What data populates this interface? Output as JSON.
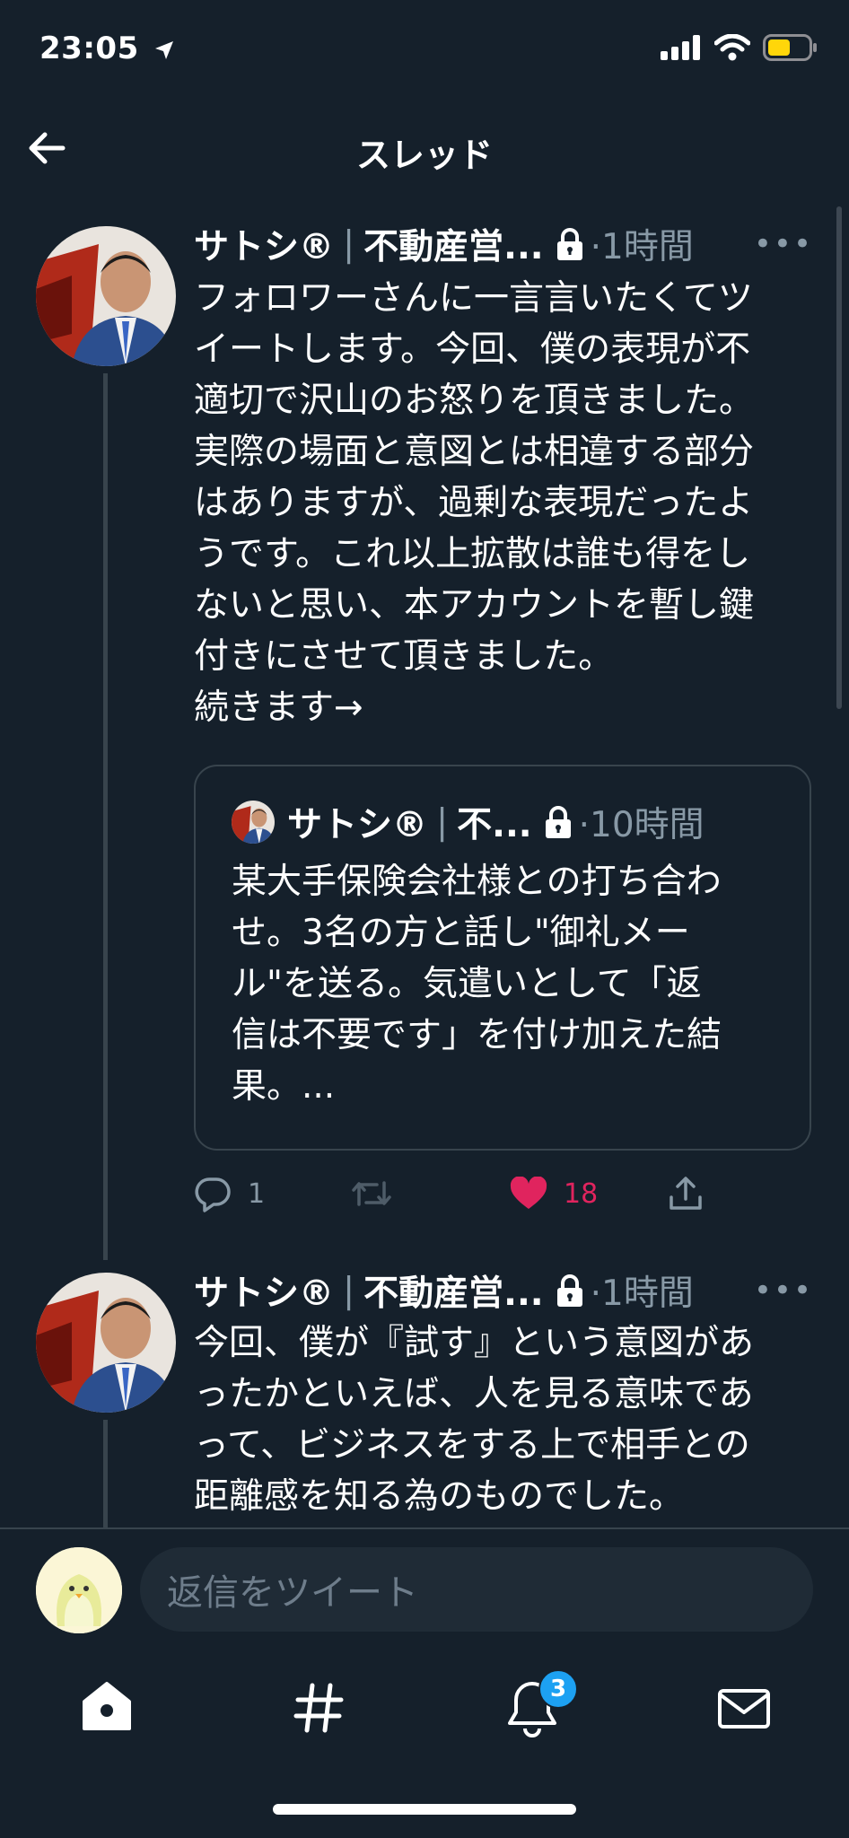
{
  "status_bar": {
    "time": "23:05"
  },
  "header": {
    "title": "スレッド"
  },
  "tweets": [
    {
      "name": "サトシ®",
      "handle": "不動産営...",
      "time": "·1時間",
      "text": "フォロワーさんに一言言いたくてツイートします。今回、僕の表現が不適切で沢山のお怒りを頂きました。実際の場面と意図とは相違する部分はありますが、過剰な表現だったようです。これ以上拡散は誰も得をしないと思い、本アカウントを暫し鍵付きにさせて頂きました。",
      "lines": [
        "フォロワーさんに一言言いたくてツ",
        "イートします。今回、僕の表現が不",
        "適切で沢山のお怒りを頂きました。",
        "実際の場面と意図とは相違する部分",
        "はありますが、過剰な表現だったよ",
        "うです。これ以上拡散は誰も得をし",
        "ないと思い、本アカウントを暫し鍵",
        "付きにさせて頂きました。",
        "続きます→"
      ],
      "quote": {
        "name": "サトシ®",
        "handle": "不...",
        "time": "·10時間",
        "lines": [
          "某大手保険会社様との打ち合わ",
          "せ。3名の方と話し\"御礼メー",
          "ル\"を送る。気遣いとして「返",
          "信は不要です」を付け加えた結",
          "果。..."
        ]
      },
      "actions": {
        "replies": "1",
        "retweets": "",
        "likes": "18"
      }
    },
    {
      "name": "サトシ®",
      "handle": "不動産営...",
      "time": "·1時間",
      "lines": [
        "今回、僕が『試す』という意図があ",
        "ったかといえば、人を見る意味であ",
        "って、ビジネスをする上で相手との",
        "距離感を知る為のものでした。"
      ]
    }
  ],
  "reply_bar": {
    "placeholder": "返信をツイート"
  },
  "tab_bar": {
    "notifications_badge": "3"
  },
  "colors": {
    "background": "#15202b",
    "like": "#e0245e",
    "secondary_text": "#8899a6",
    "accent": "#1da1f2"
  }
}
